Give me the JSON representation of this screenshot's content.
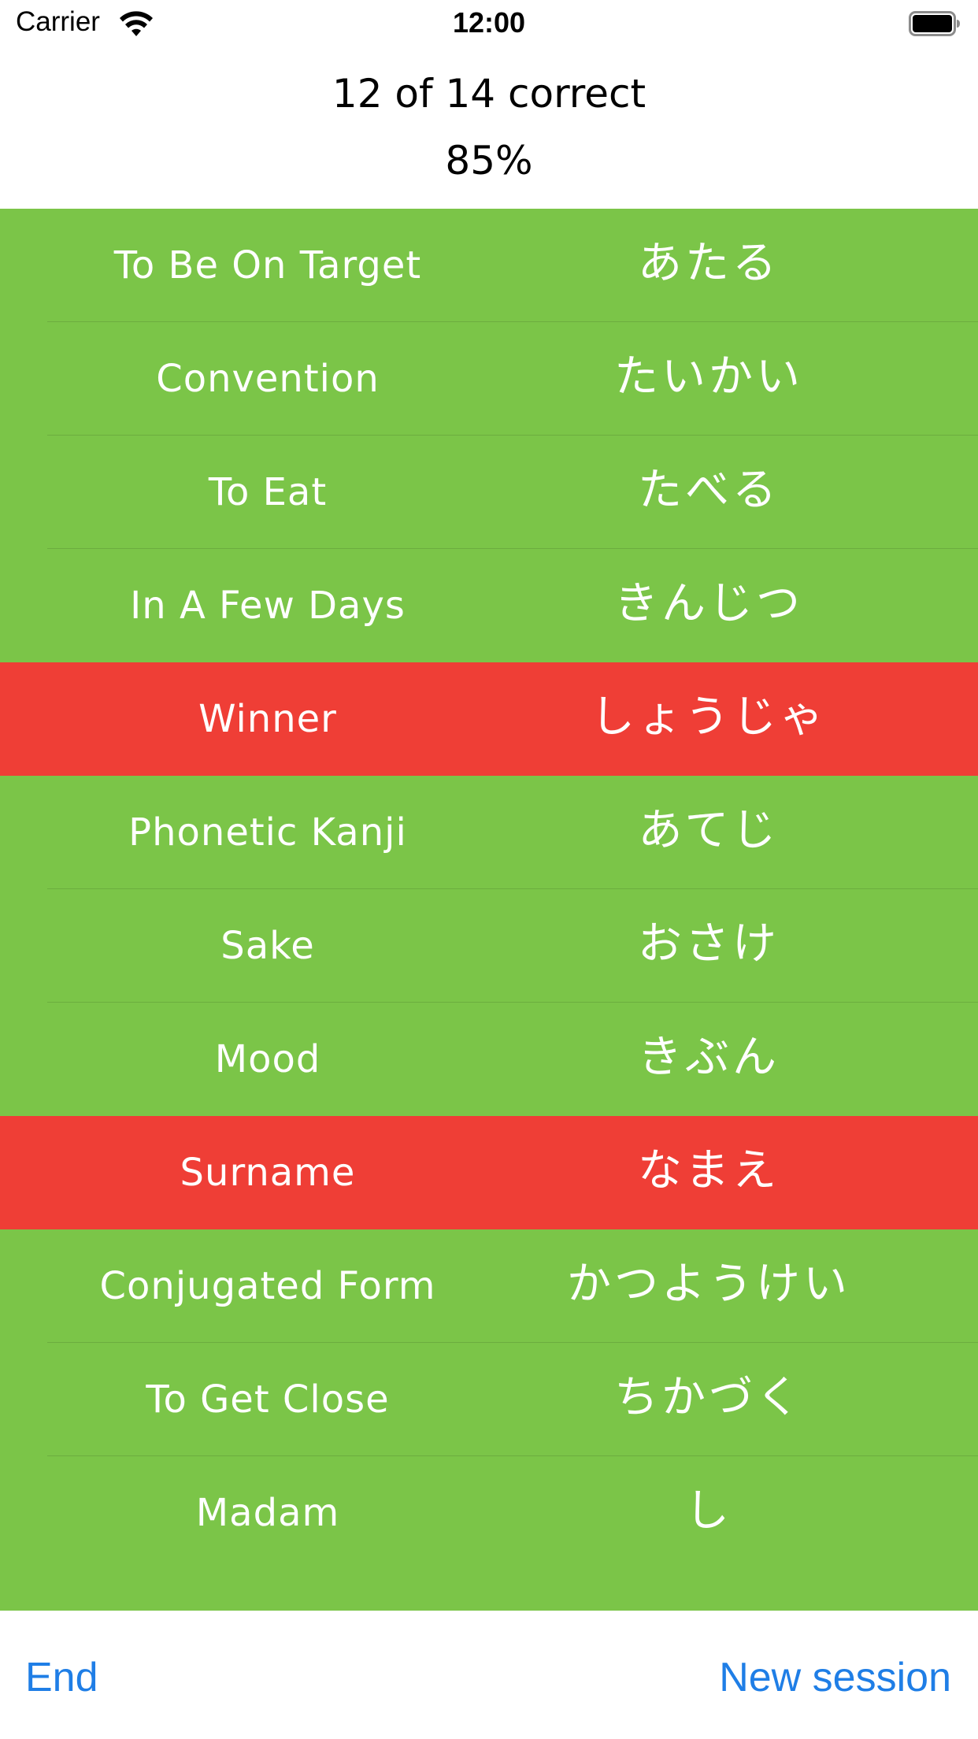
{
  "status_bar": {
    "carrier": "Carrier",
    "time": "12:00",
    "icons": [
      "wifi-icon",
      "battery-icon"
    ]
  },
  "summary": {
    "score_text": "12 of 14 correct",
    "percent_text": "85%"
  },
  "colors": {
    "correct": "#7bc548",
    "incorrect": "#ef3e36",
    "toolbar_link": "#1f7ee6"
  },
  "results": [
    {
      "english": "To Be On Target",
      "kana": "あたる",
      "status": "correct"
    },
    {
      "english": "Convention",
      "kana": "たいかい",
      "status": "correct"
    },
    {
      "english": "To Eat",
      "kana": "たべる",
      "status": "correct"
    },
    {
      "english": "In A Few Days",
      "kana": "きんじつ",
      "status": "correct"
    },
    {
      "english": "Winner",
      "kana": "しょうじゃ",
      "status": "incorrect"
    },
    {
      "english": "Phonetic Kanji",
      "kana": "あてじ",
      "status": "correct"
    },
    {
      "english": "Sake",
      "kana": "おさけ",
      "status": "correct"
    },
    {
      "english": "Mood",
      "kana": "きぶん",
      "status": "correct"
    },
    {
      "english": "Surname",
      "kana": "なまえ",
      "status": "incorrect"
    },
    {
      "english": "Conjugated Form",
      "kana": "かつようけい",
      "status": "correct"
    },
    {
      "english": "To Get Close",
      "kana": "ちかづく",
      "status": "correct"
    },
    {
      "english": "Madam",
      "kana": "し",
      "status": "correct"
    }
  ],
  "toolbar": {
    "end_label": "End",
    "new_session_label": "New session"
  }
}
